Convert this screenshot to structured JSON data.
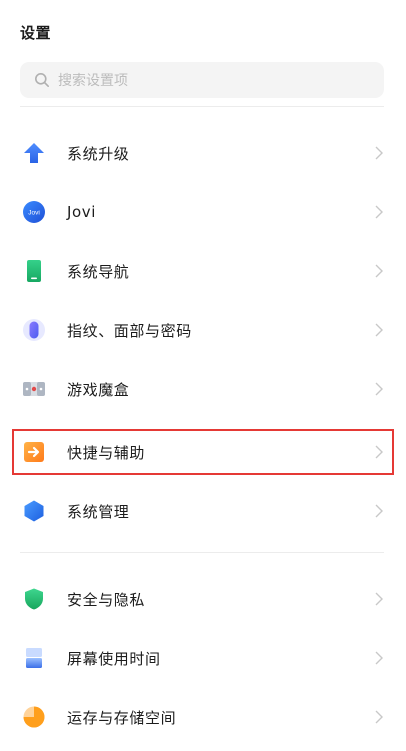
{
  "header": {
    "title": "设置"
  },
  "search": {
    "placeholder": "搜索设置项"
  },
  "items": [
    {
      "label": "系统升级",
      "icon": "arrow-up-icon"
    },
    {
      "label": "Jovi",
      "icon": "jovi-icon",
      "icon_text": "Jovi"
    },
    {
      "label": "系统导航",
      "icon": "phone-icon"
    },
    {
      "label": "指纹、面部与密码",
      "icon": "fingerprint-icon"
    },
    {
      "label": "游戏魔盒",
      "icon": "game-box-icon"
    },
    {
      "label": "快捷与辅助",
      "icon": "shortcut-icon"
    },
    {
      "label": "系统管理",
      "icon": "hexagon-icon"
    },
    {
      "label": "安全与隐私",
      "icon": "shield-icon"
    },
    {
      "label": "屏幕使用时间",
      "icon": "hourglass-icon"
    },
    {
      "label": "运存与存储空间",
      "icon": "pie-chart-icon"
    }
  ],
  "colors": {
    "highlight_border": "#e53935",
    "chevron": "#c8c8c8"
  }
}
